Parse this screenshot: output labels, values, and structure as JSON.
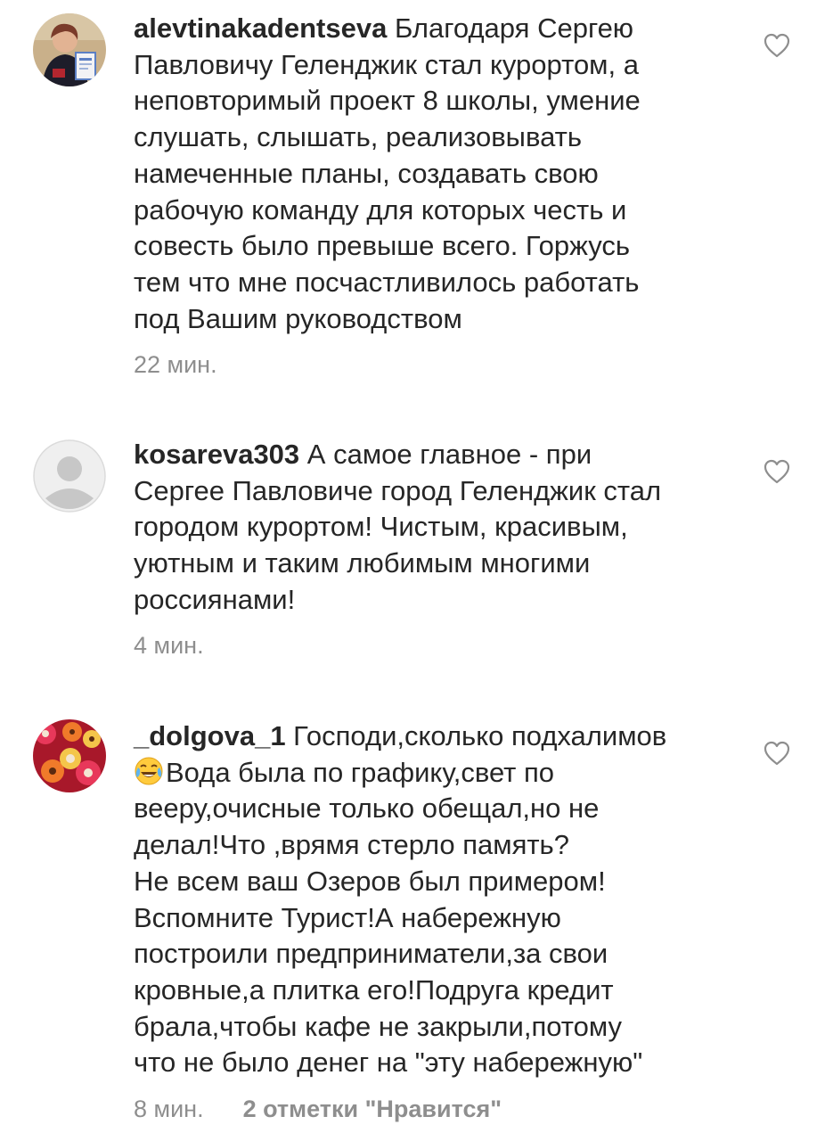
{
  "comments": [
    {
      "username": "alevtinakadentseva",
      "text": " Благодаря Сергею\nПавловичу Геленджик стал курортом, а\nнеповторимый проект 8 школы, умение\nслушать, слышать, реализовывать\nнамеченные планы, создавать свою\nрабочую команду для которых честь и\nсовесть было превыше всего. Горжусь\nтем  что мне посчастливилось работать\nпод  Вашим руководством",
      "time": "22 мин.",
      "avatar_icon": "user-photo-avatar",
      "like_icon": "heart-outline-icon"
    },
    {
      "username": "kosareva303",
      "text": " А самое главное - при\nСергее Павловиче город Геленджик стал\nгородом курортом! Чистым, красивым,\nуютным и таким любимым многими\nроссиянами!",
      "time": "4 мин.",
      "avatar_icon": "default-avatar-icon",
      "like_icon": "heart-outline-icon"
    },
    {
      "username": "_dolgova_1",
      "text_first": " Господи,сколько подхалимов",
      "emoji": "😂",
      "text_rest": "Вода была по графику,свет по\nвееру,очисные только обещал,но не\nделал!Что ,врямя стерло память?\nНе всем ваш Озеров был примером!\nВспомните Турист!А набережную\nпостроили предприниматели,за свои\nкровные,а плитка его!Подруга кредит\nбрала,чтобы кафе не закрыли,потому\nчто не было денег на \"эту набережную\"",
      "time": "8 мин.",
      "likes": "2 отметки \"Нравится\"",
      "avatar_icon": "flowers-avatar",
      "like_icon": "heart-outline-icon"
    }
  ],
  "colors": {
    "text": "#262626",
    "secondary": "#8e8e8e",
    "background": "#ffffff"
  }
}
